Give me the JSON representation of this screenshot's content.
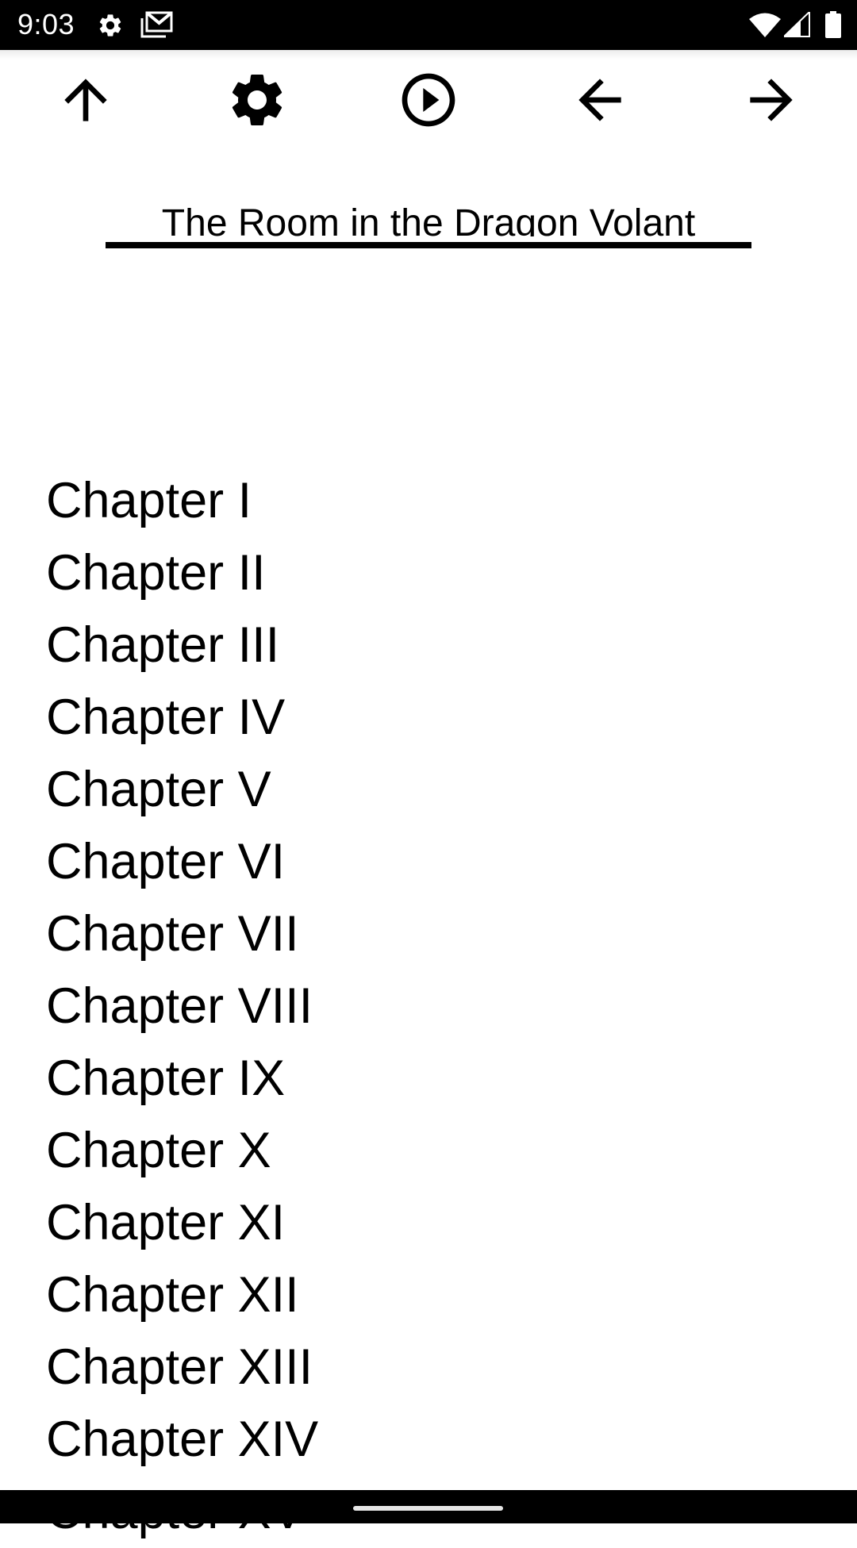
{
  "status_bar": {
    "time": "9:03",
    "notification_icons": [
      "settings-icon",
      "gmail-icon"
    ],
    "system_icons": [
      "wifi-icon",
      "cellular-signal-icon",
      "battery-icon"
    ]
  },
  "toolbar": {
    "buttons": [
      {
        "name": "up",
        "icon": "arrow-up-icon"
      },
      {
        "name": "settings",
        "icon": "gear-icon"
      },
      {
        "name": "play",
        "icon": "play-circle-icon"
      },
      {
        "name": "previous",
        "icon": "arrow-left-icon"
      },
      {
        "name": "next",
        "icon": "arrow-right-icon"
      }
    ]
  },
  "book": {
    "title": "The Room in the Dragon Volant"
  },
  "chapters": [
    {
      "label": "Chapter I"
    },
    {
      "label": "Chapter II"
    },
    {
      "label": "Chapter III"
    },
    {
      "label": "Chapter IV"
    },
    {
      "label": "Chapter V"
    },
    {
      "label": "Chapter VI"
    },
    {
      "label": "Chapter VII"
    },
    {
      "label": "Chapter VIII"
    },
    {
      "label": "Chapter IX"
    },
    {
      "label": "Chapter X"
    },
    {
      "label": "Chapter XI"
    },
    {
      "label": "Chapter XII"
    },
    {
      "label": "Chapter XIII"
    },
    {
      "label": "Chapter XIV"
    },
    {
      "label": "Chapter XV"
    }
  ],
  "colors": {
    "background": "#ffffff",
    "text": "#000000",
    "system_bars": "#000000"
  }
}
